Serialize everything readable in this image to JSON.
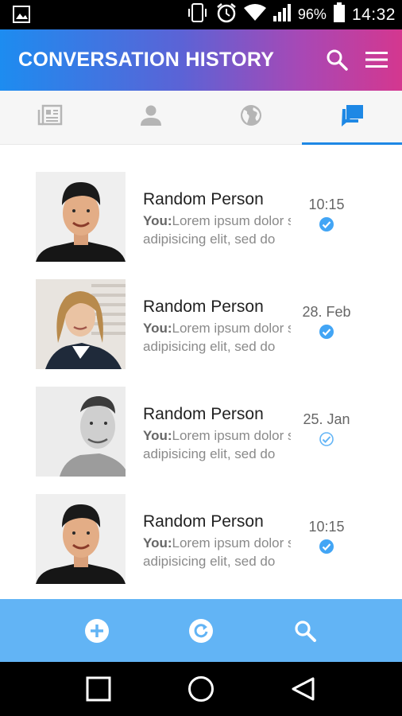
{
  "status_bar": {
    "battery": "96%",
    "time": "14:32",
    "icons": [
      "image-icon",
      "phone-vibrate-icon",
      "alarm-icon",
      "wifi-icon",
      "signal-icon",
      "battery-icon"
    ]
  },
  "app_bar": {
    "title": "CONVERSATION HISTORY",
    "actions": [
      "search-icon",
      "menu-icon"
    ]
  },
  "tabs": [
    {
      "icon": "news-icon",
      "active": false
    },
    {
      "icon": "person-icon",
      "active": false
    },
    {
      "icon": "globe-icon",
      "active": false
    },
    {
      "icon": "chat-icon",
      "active": true
    }
  ],
  "conversations": [
    {
      "name": "Random Person",
      "prefix": "You:",
      "preview_line1": "Lorem ipsum dolor sit amet,",
      "preview_line2": "adipisicing elit, sed do",
      "time": "10:15",
      "status": "read"
    },
    {
      "name": "Random Person",
      "prefix": "You:",
      "preview_line1": "Lorem ipsum dolor sit amet,",
      "preview_line2": "adipisicing elit, sed do",
      "time": "28. Feb",
      "status": "read"
    },
    {
      "name": "Random Person",
      "prefix": "You:",
      "preview_line1": "Lorem ipsum dolor sit amet,",
      "preview_line2": "adipisicing elit, sed do",
      "time": "25. Jan",
      "status": "sent"
    },
    {
      "name": "Random Person",
      "prefix": "You:",
      "preview_line1": "Lorem ipsum dolor sit amet,",
      "preview_line2": "adipisicing elit, sed do",
      "time": "10:15",
      "status": "read"
    }
  ],
  "bottom_bar": [
    "add-circle-icon",
    "refresh-icon",
    "search-icon"
  ],
  "nav_bar": [
    "recents-square-icon",
    "home-circle-icon",
    "back-triangle-icon"
  ],
  "colors": {
    "accent": "#1e88e5",
    "bottom_bar": "#62b4f5",
    "check": "#42a5f5"
  }
}
